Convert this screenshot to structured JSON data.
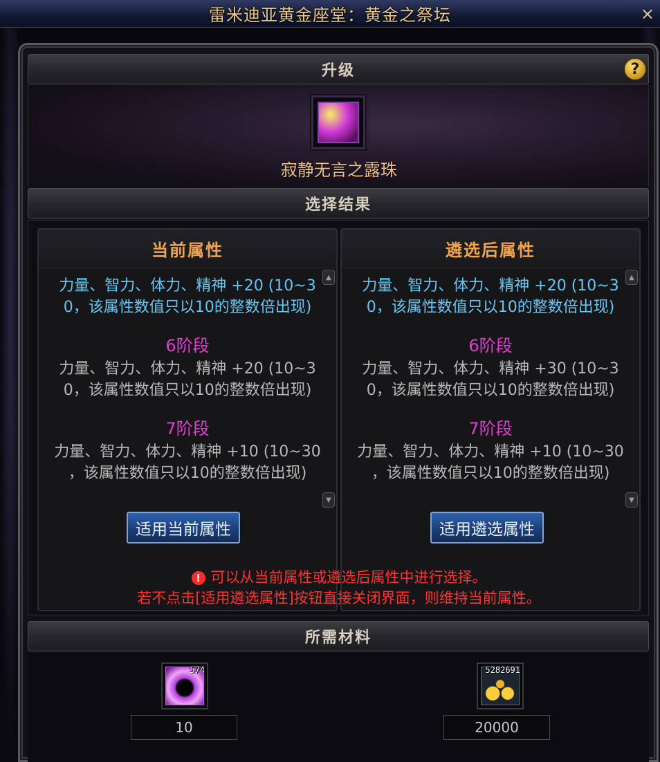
{
  "window": {
    "title": "雷米迪亚黄金座堂：黄金之祭坛",
    "close_icon": "×"
  },
  "upgrade": {
    "header": "升级",
    "help_icon": "?",
    "item_name": "寂静无言之露珠"
  },
  "result": {
    "header": "选择结果"
  },
  "current": {
    "title": "当前属性",
    "line1": "力量、智力、体力、精神 +20 (10~3",
    "line2": "0，该属性数值只以10的整数倍出现)",
    "stage6": "6阶段",
    "s6_line1": "力量、智力、体力、精神 +20 (10~3",
    "s6_line2": "0，该属性数值只以10的整数倍出现)",
    "stage7": "7阶段",
    "s7_line1": "力量、智力、体力、精神 +10 (10~30",
    "s7_line2": "，该属性数值只以10的整数倍出现)",
    "button": "适用当前属性"
  },
  "reroll": {
    "title": "遴选后属性",
    "line1": "力量、智力、体力、精神 +20 (10~3",
    "line2": "0，该属性数值只以10的整数倍出现)",
    "stage6": "6阶段",
    "s6_line1": "力量、智力、体力、精神 +30 (10~3",
    "s6_line2": "0，该属性数值只以10的整数倍出现)",
    "stage7": "7阶段",
    "s7_line1": "力量、智力、体力、精神 +10 (10~30",
    "s7_line2": "，该属性数值只以10的整数倍出现)",
    "button": "适用遴选属性"
  },
  "warning": {
    "icon": "!",
    "line1": "可以从当前属性或遴选后属性中进行选择。",
    "line2": "若不点击[适用遴选属性]按钮直接关闭界面，则维持当前属性。"
  },
  "materials": {
    "header": "所需材料",
    "item1_count": "574",
    "item1_qty": "10",
    "item2_count": "5282691",
    "item2_qty": "20000"
  },
  "colors": {
    "blue_text": "#63c6f3",
    "stage_text": "#e43bd3",
    "panel_title": "#f0a34a",
    "warning": "#ff3030"
  }
}
